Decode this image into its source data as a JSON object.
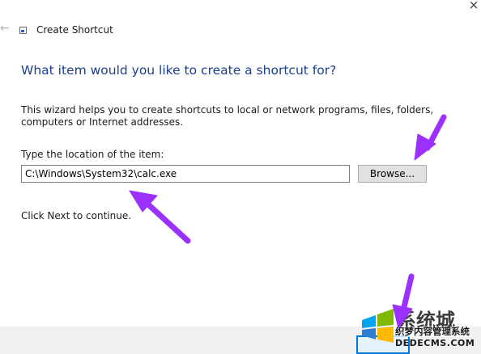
{
  "window": {
    "title": "Create Shortcut",
    "back_icon": "back-arrow-icon",
    "close_glyph": "×"
  },
  "wizard": {
    "heading": "What item would you like to create a shortcut for?",
    "description": "This wizard helps you to create shortcuts to local or network programs, files, folders, computers or Internet addresses.",
    "location_label": "Type the location of the item:",
    "location_value": "C:\\Windows\\System32\\calc.exe",
    "browse_label": "Browse...",
    "next_hint": "Click Next to continue."
  },
  "watermark": {
    "brand_cn": "系统城",
    "line_cn": "织梦内容管理系统",
    "url": "DEDECMS.COM"
  },
  "colors": {
    "heading": "#1a3f8e",
    "annotation_arrow": "#9b30ff",
    "focus_border": "#0078d7"
  }
}
